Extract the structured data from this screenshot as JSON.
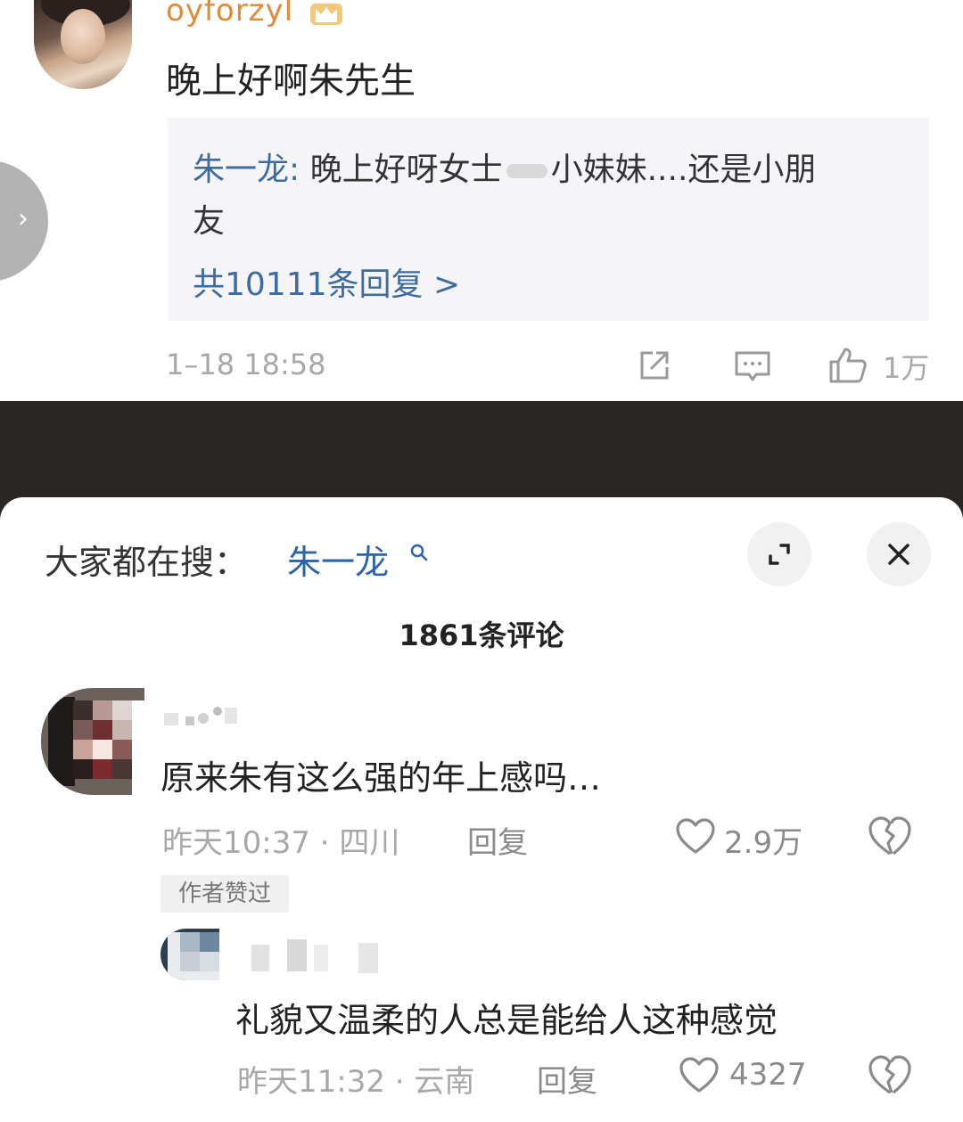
{
  "top_comment": {
    "username": "oyforzyl",
    "text": "晚上好啊朱先生",
    "reply": {
      "author": "朱一龙:",
      "text": "晚上好呀女士      小妹妹....还是小朋友",
      "text_line1": "晚上好呀女士",
      "text_line1b": "小妹妹....还是小朋",
      "text_line2": "友",
      "count_label": "共10111条回复 >"
    },
    "time": "1–18 18:58",
    "likes": "1万",
    "arrow": "›"
  },
  "sheet": {
    "search_label": "大家都在搜：",
    "search_keyword": "朱一龙",
    "comment_count": "1861条评论",
    "comments": [
      {
        "text": "原来朱有这么强的年上感吗…",
        "meta": "昨天10:37 · 四川",
        "reply_label": "回复",
        "likes": "2.9万",
        "badge": "作者赞过"
      },
      {
        "text": "礼貌又温柔的人总是能给人这种感觉",
        "meta": "昨天11:32 · 云南",
        "reply_label": "回复",
        "likes": "4327"
      }
    ]
  },
  "colors": {
    "username": "#e08a3a",
    "link_blue": "#3f6c9f",
    "search_blue": "#2d63a8",
    "meta_grey": "#a8a8a8"
  },
  "icons": [
    "crown-icon",
    "share-icon",
    "comment-icon",
    "like-icon",
    "search-icon",
    "expand-icon",
    "close-icon",
    "heart-icon",
    "broken-heart-icon"
  ]
}
